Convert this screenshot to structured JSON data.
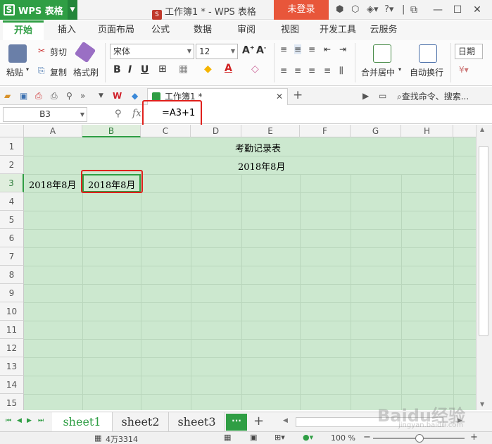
{
  "titlebar": {
    "app_name": "WPS 表格",
    "doc_title": "工作簿1 * - WPS 表格",
    "login_label": "未登录"
  },
  "ribbon_tabs": [
    "开始",
    "插入",
    "页面布局",
    "公式",
    "数据",
    "审阅",
    "视图",
    "开发工具",
    "云服务"
  ],
  "ribbon": {
    "paste": "粘贴",
    "cut": "剪切",
    "copy": "复制",
    "format_painter": "格式刷",
    "font_name": "宋体",
    "font_size": "12",
    "merge_center": "合并居中",
    "wrap_text": "自动换行",
    "number_format": "日期"
  },
  "quick_access": {
    "doc_tab": "工作簿1 *",
    "search_placeholder": "查找命令、搜索..."
  },
  "formula_bar": {
    "name_box": "B3",
    "formula": "=A3+1"
  },
  "grid": {
    "columns": [
      "A",
      "B",
      "C",
      "D",
      "E",
      "F",
      "G",
      "H"
    ],
    "rows": [
      "1",
      "2",
      "3",
      "4",
      "5",
      "6",
      "7",
      "8",
      "9",
      "10",
      "11",
      "12",
      "13",
      "14",
      "15"
    ],
    "selected_cell": "B3",
    "cells": {
      "E1": "考勤记录表",
      "E2": "2018年8月",
      "A3": "2018年8月",
      "B3": "2018年8月"
    }
  },
  "sheets": [
    "sheet1",
    "sheet2",
    "sheet3"
  ],
  "active_sheet": "sheet1",
  "statusbar": {
    "count": "4万3314",
    "zoom": "100 %"
  },
  "watermark": {
    "brand": "Baidu经验",
    "url": "jingyan.baidu.com"
  },
  "colors": {
    "accent": "#2f9e44",
    "grid_bg": "#cce8cf",
    "highlight": "#e0201c",
    "login": "#e8563a"
  }
}
